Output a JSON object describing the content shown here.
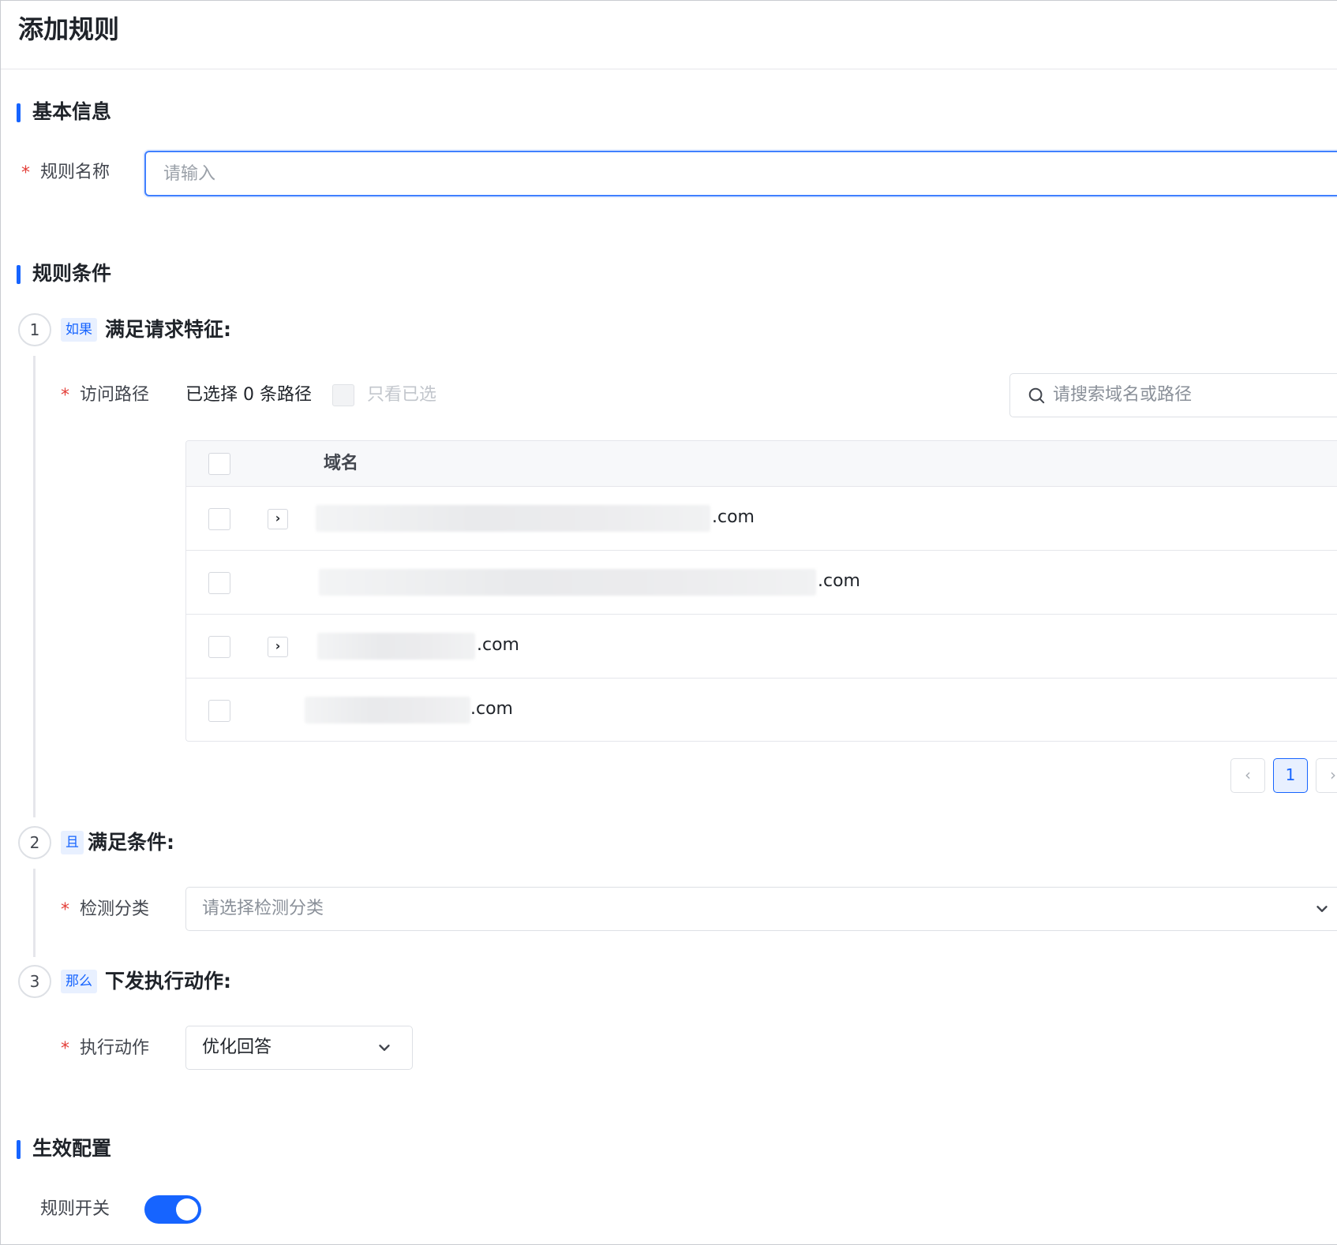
{
  "header": {
    "title": "添加规则"
  },
  "sections": {
    "basic": {
      "title": "基本信息"
    },
    "conditions": {
      "title": "规则条件"
    },
    "effect": {
      "title": "生效配置"
    }
  },
  "basic_form": {
    "name_label": "规则名称",
    "name_placeholder": "请输入",
    "name_value": ""
  },
  "steps": [
    {
      "number": "1",
      "tag": "如果",
      "title": "满足请求特征:"
    },
    {
      "number": "2",
      "tag": "且",
      "title": "满足条件:"
    },
    {
      "number": "3",
      "tag": "那么",
      "title": "下发执行动作:"
    }
  ],
  "path_selector": {
    "label": "访问路径",
    "selected_text": "已选择 0 条路径",
    "only_selected_label": "只看已选",
    "search_placeholder": "请搜索域名或路径"
  },
  "table": {
    "column_domain": "域名",
    "rows": [
      {
        "domain_suffix": ".com",
        "expandable": true,
        "checked": false
      },
      {
        "domain_suffix": ".com",
        "expandable": false,
        "checked": false
      },
      {
        "domain_suffix": ".com",
        "expandable": true,
        "checked": false
      },
      {
        "domain_suffix": ".com",
        "expandable": false,
        "checked": false
      }
    ]
  },
  "pagination": {
    "prev": "‹",
    "current_page": "1",
    "next": "›"
  },
  "detect_category": {
    "label": "检测分类",
    "placeholder": "请选择检测分类"
  },
  "action": {
    "label": "执行动作",
    "value": "优化回答"
  },
  "effect_form": {
    "switch_label": "规则开关",
    "switch_on": true
  },
  "colors": {
    "accent": "#1664ff",
    "required": "#e33e38",
    "tag_bg": "#e8f0ff"
  }
}
